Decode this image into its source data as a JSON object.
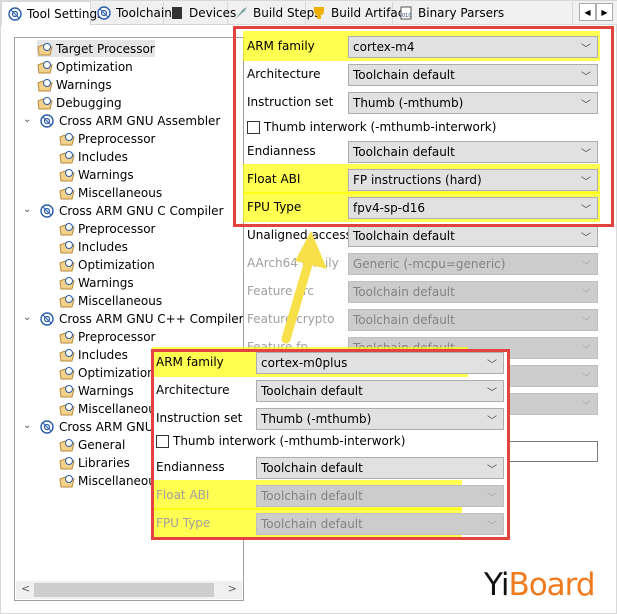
{
  "tabs": [
    {
      "label": "Tool Settings",
      "icon": "tool-settings-icon",
      "selected": true
    },
    {
      "label": "Toolchains",
      "icon": "toolchains-icon"
    },
    {
      "label": "Devices",
      "icon": "devices-icon"
    },
    {
      "label": "Build Steps",
      "icon": "build-steps-icon"
    },
    {
      "label": "Build Artifact",
      "icon": "build-artifact-icon"
    },
    {
      "label": "Binary Parsers",
      "icon": "binary-parsers-icon"
    }
  ],
  "tab_scroll": {
    "left": "◀",
    "right": "▶"
  },
  "tree": [
    {
      "label": "Target Processor",
      "level": 1,
      "selected": true
    },
    {
      "label": "Optimization",
      "level": 1
    },
    {
      "label": "Warnings",
      "level": 1
    },
    {
      "label": "Debugging",
      "level": 1
    },
    {
      "label": "Cross ARM GNU Assembler",
      "level": 0,
      "expanded": true
    },
    {
      "label": "Preprocessor",
      "level": 2
    },
    {
      "label": "Includes",
      "level": 2
    },
    {
      "label": "Warnings",
      "level": 2
    },
    {
      "label": "Miscellaneous",
      "level": 2
    },
    {
      "label": "Cross ARM GNU C Compiler",
      "level": 0,
      "expanded": true
    },
    {
      "label": "Preprocessor",
      "level": 2
    },
    {
      "label": "Includes",
      "level": 2
    },
    {
      "label": "Optimization",
      "level": 2
    },
    {
      "label": "Warnings",
      "level": 2
    },
    {
      "label": "Miscellaneous",
      "level": 2
    },
    {
      "label": "Cross ARM GNU C++ Compiler",
      "level": 0,
      "expanded": true
    },
    {
      "label": "Preprocessor",
      "level": 2
    },
    {
      "label": "Includes",
      "level": 2
    },
    {
      "label": "Optimization",
      "level": 2
    },
    {
      "label": "Warnings",
      "level": 2
    },
    {
      "label": "Miscellaneous",
      "level": 2
    },
    {
      "label": "Cross ARM GNU C",
      "level": 0,
      "expanded": true
    },
    {
      "label": "General",
      "level": 2
    },
    {
      "label": "Libraries",
      "level": 2
    },
    {
      "label": "Miscellaneous",
      "level": 2
    }
  ],
  "settings": [
    {
      "label": "ARM family",
      "value": "cortex-m4",
      "type": "combo",
      "highlight": true
    },
    {
      "label": "Architecture",
      "value": "Toolchain default",
      "type": "combo"
    },
    {
      "label": "Instruction set",
      "value": "Thumb (-mthumb)",
      "type": "combo"
    },
    {
      "label": "Thumb interwork (-mthumb-interwork)",
      "type": "checkbox",
      "checked": false
    },
    {
      "label": "Endianness",
      "value": "Toolchain default",
      "type": "combo"
    },
    {
      "label": "Float ABI",
      "value": "FP instructions (hard)",
      "type": "combo",
      "highlight": true
    },
    {
      "label": "FPU Type",
      "value": "fpv4-sp-d16",
      "type": "combo",
      "highlight": true
    },
    {
      "label": "Unaligned access",
      "value": "Toolchain default",
      "type": "combo"
    },
    {
      "label": "AArch64 family",
      "value": "Generic (-mcpu=generic)",
      "type": "combo",
      "disabled": true
    },
    {
      "label": "Feature crc",
      "value": "Toolchain default",
      "type": "combo",
      "disabled": true
    },
    {
      "label": "Feature crypto",
      "value": "Toolchain default",
      "type": "combo",
      "disabled": true
    },
    {
      "label": "Feature fp",
      "value": "Toolchain default",
      "type": "combo",
      "disabled": true
    }
  ],
  "overlay_settings": [
    {
      "label": "ARM family",
      "value": "cortex-m0plus",
      "type": "combo",
      "highlight": true
    },
    {
      "label": "Architecture",
      "value": "Toolchain default",
      "type": "combo"
    },
    {
      "label": "Instruction set",
      "value": "Thumb (-mthumb)",
      "type": "combo"
    },
    {
      "label": "Thumb interwork (-mthumb-interwork)",
      "type": "checkbox",
      "checked": false
    },
    {
      "label": "Endianness",
      "value": "Toolchain default",
      "type": "combo"
    },
    {
      "label": "Float ABI",
      "value": "Toolchain default",
      "type": "combo",
      "disabled": true,
      "highlight": true
    },
    {
      "label": "FPU Type",
      "value": "Toolchain default",
      "type": "combo",
      "disabled": true,
      "highlight": true
    }
  ],
  "logo": {
    "part1": "Yi",
    "part2": "Board",
    "color1": "#111111",
    "color2": "#f07a1e"
  },
  "colors": {
    "highlight": "#ffff00",
    "annotation_box": "#e3433f",
    "arrow": "#f8e04a"
  }
}
